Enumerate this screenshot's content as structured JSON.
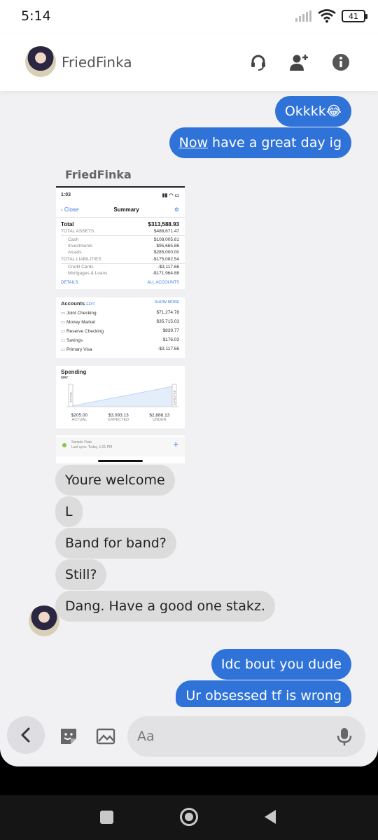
{
  "status_bar": {
    "time": "5:14",
    "battery": "41"
  },
  "header": {
    "contact_name": "FriedFinka"
  },
  "messages_top": [
    {
      "text": "Okkkk😂"
    },
    {
      "underlined": "Now",
      "rest": " have a great day ig"
    }
  ],
  "shared_image": {
    "sender_label": "FriedFinka",
    "phone_time": "1:03",
    "nav": {
      "close": "Close",
      "title": "Summary"
    },
    "total": {
      "label": "Total",
      "value": "$313,588.93"
    },
    "total_assets": {
      "label": "TOTAL ASSETS",
      "value": "$488,671.47"
    },
    "assets": [
      {
        "label": "Cash",
        "value": "$108,005.61"
      },
      {
        "label": "Investments",
        "value": "$95,665.86"
      },
      {
        "label": "Assets",
        "value": "$285,000.00"
      }
    ],
    "total_liabilities": {
      "label": "TOTAL LIABILITIES",
      "value": "-$175,082.54"
    },
    "liabilities": [
      {
        "label": "Credit Cards",
        "value": "-$3,117.66"
      },
      {
        "label": "Mortgages & Loans",
        "value": "-$171,964.88"
      }
    ],
    "details_link": "DETAILS",
    "all_accounts_link": "ALL ACCOUNTS",
    "accounts": {
      "title": "Accounts",
      "edit": "EDIT",
      "show_more": "SHOW MORE",
      "items": [
        {
          "name": "Joint Checking",
          "value": "$71,274.78"
        },
        {
          "name": "Money Market",
          "value": "$35,715.03"
        },
        {
          "name": "Reserve Checking",
          "value": "$839.77"
        },
        {
          "name": "Savings",
          "value": "$176.03"
        },
        {
          "name": "Primary Visa",
          "value": "-$3,117.66"
        }
      ]
    },
    "spending": {
      "title": "Spending",
      "month": "MAY",
      "bar_actual": "ACTUAL",
      "bar_expected": "EXPECTED",
      "stats": [
        {
          "value": "$205.00",
          "label": "ACTUAL"
        },
        {
          "value": "$3,093.13",
          "label": "EXPECTED"
        },
        {
          "value": "$2,888.13",
          "label": "UNDER"
        }
      ]
    },
    "footer": {
      "line1": "Sample Data",
      "line2": "Last sync: Today, 1:01 PM",
      "plus": "+"
    }
  },
  "messages_in": [
    {
      "text": "Youre welcome"
    },
    {
      "text": "L"
    },
    {
      "text": "Band for band?"
    },
    {
      "text": "Still?"
    },
    {
      "text": "Dang. Have a good one stakz."
    }
  ],
  "messages_bottom": [
    {
      "text": "Idc bout you dude"
    },
    {
      "text": "Ur obsessed tf is wrong"
    }
  ],
  "composer": {
    "placeholder": "Aa"
  },
  "colors": {
    "outgoing_bubble": "#2f73d9",
    "incoming_bubble": "#dcdcdd",
    "background": "#f1f1f3"
  }
}
